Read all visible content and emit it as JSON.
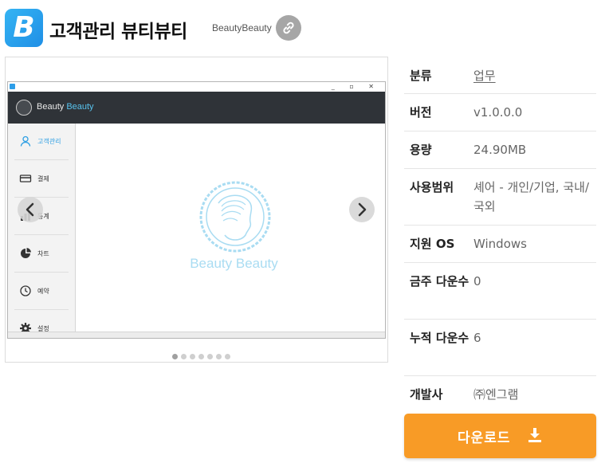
{
  "app": {
    "icon_letter": "B",
    "title": "고객관리 뷰티뷰티",
    "developer_name": "BeautyBeauty"
  },
  "screenshot": {
    "window_controls": "_ ▫ ✕",
    "header_brand": "Beauty",
    "header_brand_accent": "Beauty",
    "sidebar": [
      {
        "label": "고객관리",
        "icon": "person-icon"
      },
      {
        "label": "결제",
        "icon": "card-icon"
      },
      {
        "label": "통계",
        "icon": "chart-icon"
      },
      {
        "label": "차트",
        "icon": "pie-chart-icon"
      },
      {
        "label": "예약",
        "icon": "clock-icon"
      },
      {
        "label": "설정",
        "icon": "gear-icon"
      }
    ],
    "brand_text": "Beauty Beauty",
    "slide_count": 7,
    "active_slide": 1
  },
  "info": {
    "rows": [
      {
        "label": "분류",
        "value": "업무",
        "link": true
      },
      {
        "label": "버전",
        "value": "v1.0.0.0"
      },
      {
        "label": "용량",
        "value": "24.90MB"
      },
      {
        "label": "사용범위",
        "value": "셰어 - 개인/기업, 국내/국외"
      },
      {
        "label": "지원 OS",
        "value": "Windows"
      },
      {
        "label": "금주 다운수",
        "value": "0"
      },
      {
        "label": "누적 다운수",
        "value": "6"
      },
      {
        "label": "개발사",
        "value": "㈜엔그램"
      }
    ]
  },
  "download": {
    "label": "다운로드"
  },
  "colors": {
    "accent_orange": "#f89b26",
    "app_icon_blue": "#2d9de8",
    "header_dark": "#2f3338",
    "brand_light_blue": "#a9dcf2"
  }
}
